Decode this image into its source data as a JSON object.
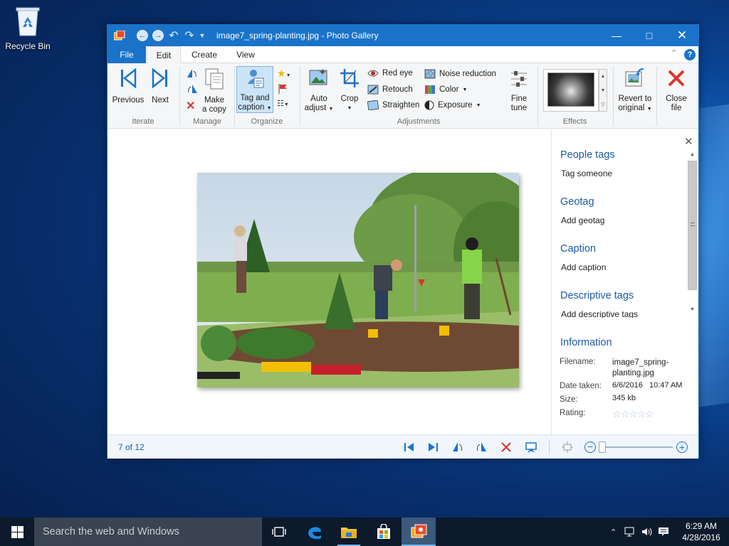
{
  "desktop": {
    "recycle_bin_label": "Recycle Bin"
  },
  "window": {
    "title": "image7_spring-planting.jpg - Photo Gallery"
  },
  "tabs": [
    {
      "label": "File"
    },
    {
      "label": "Edit"
    },
    {
      "label": "Create"
    },
    {
      "label": "View"
    }
  ],
  "ribbon": {
    "iterate": {
      "label": "Iterate",
      "previous": "Previous",
      "next": "Next"
    },
    "manage": {
      "label": "Manage",
      "make_copy_1": "Make",
      "make_copy_2": "a copy"
    },
    "organize": {
      "label": "Organize",
      "tag_caption_1": "Tag and",
      "tag_caption_2": "caption"
    },
    "adjustments": {
      "label": "Adjustments",
      "auto_adjust_1": "Auto",
      "auto_adjust_2": "adjust",
      "crop": "Crop",
      "red_eye": "Red eye",
      "retouch": "Retouch",
      "straighten": "Straighten",
      "noise_reduction": "Noise reduction",
      "color": "Color",
      "exposure": "Exposure",
      "fine_tune_1": "Fine",
      "fine_tune_2": "tune"
    },
    "effects": {
      "label": "Effects"
    },
    "revert_1": "Revert to",
    "revert_2": "original",
    "close_1": "Close",
    "close_2": "file"
  },
  "pane": {
    "people_tags": {
      "title": "People tags",
      "action": "Tag someone"
    },
    "geotag": {
      "title": "Geotag",
      "action": "Add geotag"
    },
    "caption": {
      "title": "Caption",
      "action": "Add caption"
    },
    "descriptive_tags": {
      "title": "Descriptive tags",
      "action": "Add descriptive tags"
    },
    "information": {
      "title": "Information",
      "filename_label": "Filename:",
      "filename_1": "image7_spring-",
      "filename_2": "planting.jpg",
      "date_label": "Date taken:",
      "date_value": "6/6/2016   10:47 AM",
      "size_label": "Size:",
      "size_value": "345 kb",
      "rating_label": "Rating:",
      "rating_value": 0
    }
  },
  "status": {
    "counter": "7 of 12",
    "zoom_level": 0.05
  },
  "taskbar": {
    "search_placeholder": "Search the web and Windows",
    "time": "6:29 AM",
    "date": "4/28/2016"
  }
}
